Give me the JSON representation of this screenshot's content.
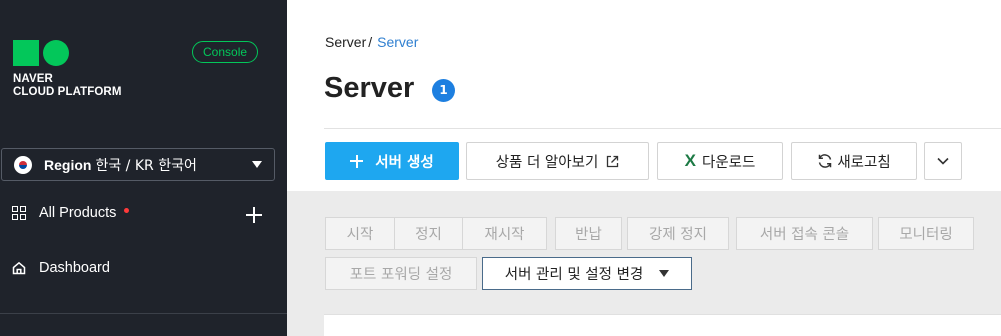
{
  "sidebar": {
    "brand_line1": "NAVER",
    "brand_line2": "CLOUD PLATFORM",
    "console_label": "Console",
    "region_label": "Region",
    "region_value": "한국 / KR 한국어",
    "nav": {
      "all_products": "All Products",
      "dashboard": "Dashboard"
    }
  },
  "main": {
    "breadcrumb": {
      "root": "Server",
      "separator": "/",
      "current": "Server"
    },
    "title": "Server",
    "count": "1",
    "toolbar": {
      "create": "서버 생성",
      "learn_more": "상품 더 알아보기",
      "download": "다운로드",
      "refresh": "새로고침"
    },
    "actions": {
      "start": "시작",
      "stop": "정지",
      "restart": "재시작",
      "return": "반납",
      "force_stop": "강제 정지",
      "console_connect": "서버 접속 콘솔",
      "monitoring": "모니터링",
      "port_forwarding": "포트 포워딩 설정",
      "manage": "서버 관리 및 설정 변경"
    }
  },
  "colors": {
    "sidebar_bg": "#1f232b",
    "brand_green": "#03c75a",
    "primary_blue": "#1ea7f0",
    "badge_blue": "#1d7fe0",
    "link_blue": "#2f7fd0",
    "excel_green": "#1d7a45"
  },
  "icons": {
    "logo": "naver-cloud-logo",
    "flag": "korea-flag-icon",
    "all_products": "grid-icon",
    "dashboard": "home-icon",
    "add": "plus-icon",
    "external": "external-link-icon",
    "excel": "excel-icon",
    "refresh": "refresh-icon",
    "more": "chevron-down-icon"
  }
}
